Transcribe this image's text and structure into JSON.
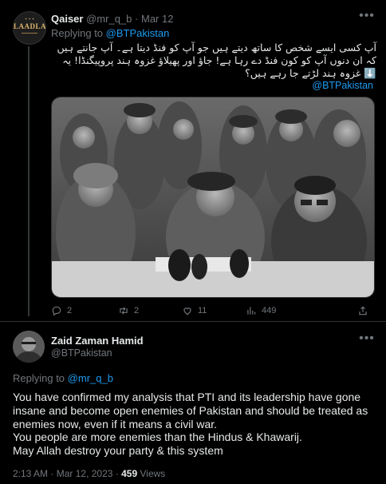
{
  "colors": {
    "background": "#000000",
    "text": "#e7e9ea",
    "muted": "#71767b",
    "link": "#1d9bf0",
    "border": "#2f3336"
  },
  "parent_tweet": {
    "avatar_icon": "laadla-avatar-icon",
    "avatar_text": "LAADLA",
    "name": "Qaiser",
    "handle": "@mr_q_b",
    "sep": "·",
    "date": "Mar 12",
    "replying_prefix": "Replying to",
    "replying_handle": "@BTPakistan",
    "urdu_text": "آپ کسی ایسے شخص کا ساتھ دیتے ہیں جو آپ کو فنڈ دیتا ہے۔ آپ جانتے ہیں کہ ان دنوں آپ کو کون فنڈ دے رہا ہے! جاؤ اور پھیلاؤ غزوہ ہند پروپیگنڈا! یہ ⬇️ غزوہ ہند لڑتے جا رہے ہیں؟",
    "tag": "@BTPakistan",
    "image_icon": "surrender-photo-image",
    "actions": {
      "replies": "2",
      "retweets": "2",
      "likes": "11",
      "views": "449"
    }
  },
  "main_tweet": {
    "name": "Zaid Zaman Hamid",
    "handle": "@BTPakistan",
    "replying_prefix": "Replying to",
    "replying_handle": "@mr_q_b",
    "body_lines": [
      "You have confirmed my analysis that PTI and its leadership have gone insane and become open enemies of Pakistan and should be treated as enemies now, even if it means a civil war.",
      "You people are more enemies than the Hindus & Khawarij.",
      "May Allah destroy your party & this system"
    ],
    "time": "2:13 AM",
    "sep": "·",
    "date": "Mar 12, 2023",
    "sep2": "·",
    "views_count": "459",
    "views_label": "Views"
  }
}
